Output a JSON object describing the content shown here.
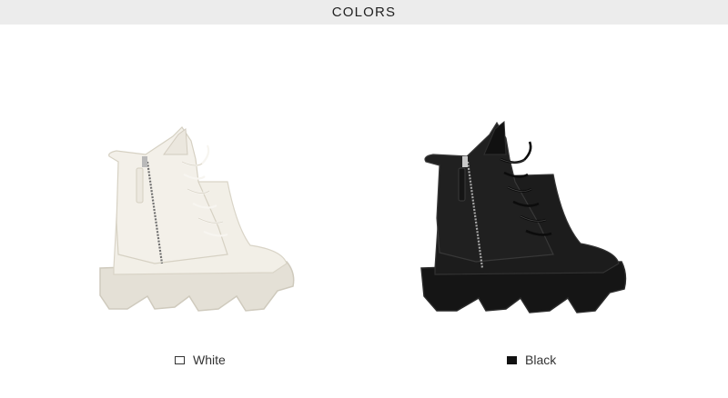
{
  "header": {
    "title": "COLORS"
  },
  "variants": [
    {
      "label": "White",
      "swatch_color": "#ffffff",
      "boot_color": "#efece3"
    },
    {
      "label": "Black",
      "swatch_color": "#111111",
      "boot_color": "#1b1b1b"
    }
  ]
}
